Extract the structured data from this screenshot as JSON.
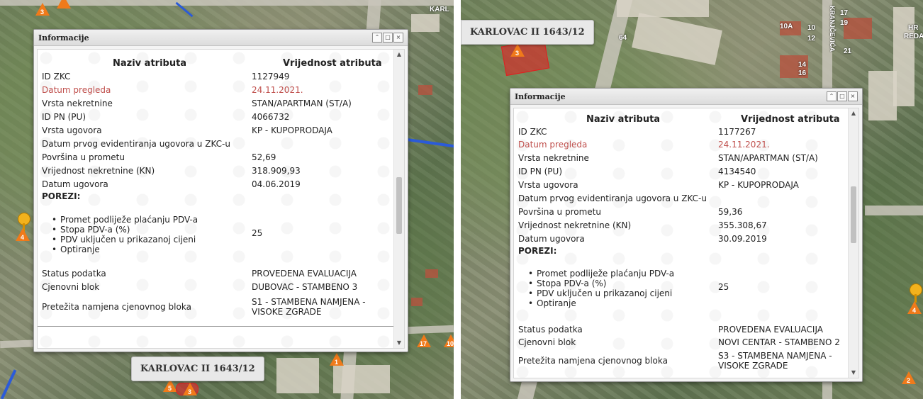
{
  "left": {
    "window": {
      "title": "Informacije",
      "buttons": {
        "collapse": "⌃",
        "maximize": "□",
        "close": "×"
      }
    },
    "headers": {
      "name": "Naziv atributa",
      "value": "Vrijednost atributa"
    },
    "rows": [
      {
        "label": "ID ZKC",
        "value": "1127949"
      },
      {
        "label": "Datum pregleda",
        "value": "24.11.2021."
      },
      {
        "label": "Vrsta nekretnine",
        "value": "STAN/APARTMAN (ST/A)"
      },
      {
        "label": "ID PN (PU)",
        "value": "4066732"
      },
      {
        "label": "Vrsta ugovora",
        "value": "KP - KUPOPRODAJA"
      },
      {
        "label": "Datum prvog evidentiranja ugovora u ZKC-u",
        "value": ""
      },
      {
        "label": "Površina u prometu",
        "value": "52,69"
      },
      {
        "label": "Vrijednost nekretnine (KN)",
        "value": "318.909,93"
      },
      {
        "label": "Datum ugovora",
        "value": "04.06.2019"
      }
    ],
    "porezi_label": "POREZI:",
    "tax_items": [
      "Promet podliježe plaćanju PDV-a",
      "Stopa PDV-a (%)",
      "PDV uključen u prikazanoj cijeni",
      "Optiranje"
    ],
    "tax_value": "25",
    "status_rows": [
      {
        "label": "Status podatka",
        "value": "PROVEDENA EVALUACIJA"
      },
      {
        "label": "Cjenovni blok",
        "value": "DUBOVAC - STAMBENO 3"
      },
      {
        "label": "Pretežita namjena cjenovnog bloka",
        "value": "S1 - STAMBENA NAMJENA - VISOKE ZGRADE"
      }
    ],
    "location_label": "KARLOVAC II 1643/12",
    "map_labels": {
      "top_right": "KARL"
    },
    "markers": [
      "3",
      "4",
      "5",
      "3",
      "17",
      "10",
      "1"
    ]
  },
  "right": {
    "window": {
      "title": "Informacije",
      "buttons": {
        "collapse": "⌃",
        "maximize": "□",
        "close": "×"
      }
    },
    "headers": {
      "name": "Naziv atributa",
      "value": "Vrijednost atributa"
    },
    "rows": [
      {
        "label": "ID ZKC",
        "value": "1177267"
      },
      {
        "label": "Datum pregleda",
        "value": "24.11.2021."
      },
      {
        "label": "Vrsta nekretnine",
        "value": "STAN/APARTMAN (ST/A)"
      },
      {
        "label": "ID PN (PU)",
        "value": "4134540"
      },
      {
        "label": "Vrsta ugovora",
        "value": "KP - KUPOPRODAJA"
      },
      {
        "label": "Datum prvog evidentiranja ugovora u ZKC-u",
        "value": ""
      },
      {
        "label": "Površina u prometu",
        "value": "59,36"
      },
      {
        "label": "Vrijednost nekretnine (KN)",
        "value": "355.308,67"
      },
      {
        "label": "Datum ugovora",
        "value": "30.09.2019"
      }
    ],
    "porezi_label": "POREZI:",
    "tax_items": [
      "Promet podliježe plaćanju PDV-a",
      "Stopa PDV-a (%)",
      "PDV uključen u prikazanoj cijeni",
      "Optiranje"
    ],
    "tax_value": "25",
    "status_rows": [
      {
        "label": "Status podatka",
        "value": "PROVEDENA EVALUACIJA"
      },
      {
        "label": "Cjenovni blok",
        "value": "NOVI CENTAR - STAMBENO 2"
      },
      {
        "label": "Pretežita namjena cjenovnog bloka",
        "value": "S3 - STAMBENA NAMJENA - VISOKE ZGRADE"
      }
    ],
    "location_label": "KARLOVAC II 1643/12",
    "map_labels": {
      "street": "KRANJČEVIĆA",
      "hr": "HR",
      "reda": "REDA",
      "n64": "64",
      "n10a": "10A",
      "n10": "10",
      "n12": "12",
      "n14": "14",
      "n16": "16",
      "n17": "17",
      "n19": "19",
      "n21": "21"
    },
    "markers": [
      "3",
      "4",
      "2"
    ]
  },
  "colors": {
    "marker": "#f07a1a",
    "highlight_label": "#c0504d",
    "river": "#2b5bd9",
    "pin": "#f2b21d"
  }
}
